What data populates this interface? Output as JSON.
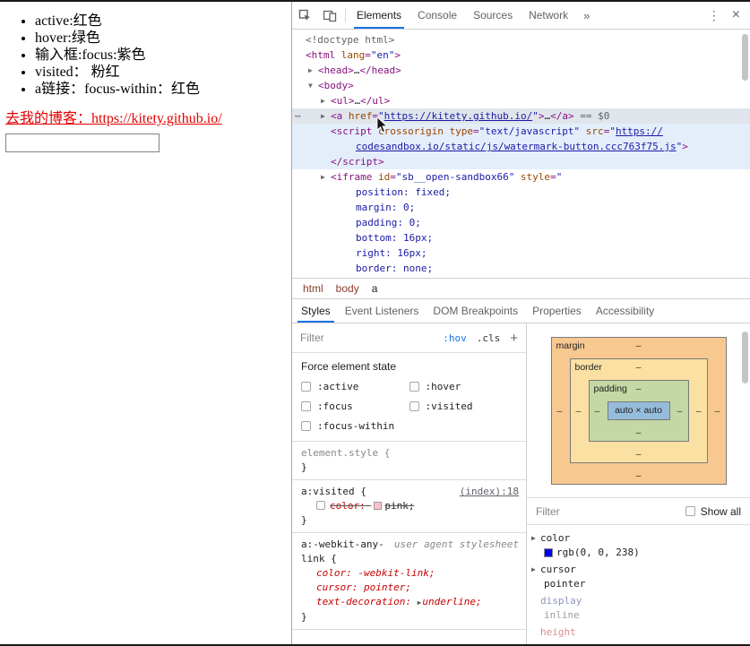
{
  "page": {
    "bullets": [
      "active:红色",
      "hover:绿色",
      "输入框:focus:紫色",
      "visited： 粉红",
      "a链接：focus-within：红色"
    ],
    "link_text": "去我的博客：https://kitety.github.io/"
  },
  "devtools": {
    "icons": {
      "expand": "▶",
      "collapse": "▼"
    },
    "toolbar": {
      "tabs": [
        "Elements",
        "Console",
        "Sources",
        "Network"
      ],
      "more": "»",
      "kebab": "⋮",
      "close": "×"
    },
    "elements": {
      "lines": [
        {
          "lv": 0,
          "segs": [
            [
              "gy",
              "<!doctype html>"
            ]
          ]
        },
        {
          "lv": 0,
          "segs": [
            [
              "tg",
              "<html"
            ],
            [
              "at",
              " lang"
            ],
            [
              "tg",
              "="
            ],
            [
              "vl",
              "\"en\""
            ],
            [
              "tg",
              ">"
            ]
          ]
        },
        {
          "lv": 1,
          "arrow": "▶",
          "segs": [
            [
              "tg",
              "<head>"
            ],
            [
              "tx",
              "…"
            ],
            [
              "tg",
              "</head>"
            ]
          ]
        },
        {
          "lv": 1,
          "arrow": "▼",
          "segs": [
            [
              "tg",
              "<body>"
            ]
          ]
        },
        {
          "lv": 2,
          "arrow": "▶",
          "segs": [
            [
              "tg",
              "<ul>"
            ],
            [
              "tx",
              "…"
            ],
            [
              "tg",
              "</ul>"
            ]
          ]
        },
        {
          "lv": 2,
          "arrow": "▶",
          "sel": true,
          "dots": "⋯",
          "segs": [
            [
              "tg",
              "<a"
            ],
            [
              "at",
              " href"
            ],
            [
              "tg",
              "="
            ],
            [
              "vl",
              "\""
            ],
            [
              "lk",
              "https://kitety.github.io/"
            ],
            [
              "vl",
              "\""
            ],
            [
              "tg",
              ">"
            ],
            [
              "tx",
              "…"
            ],
            [
              "tg",
              "</a>"
            ],
            [
              "mt",
              " == $0"
            ]
          ]
        },
        {
          "lv": 2,
          "hl": true,
          "segs": [
            [
              "tg",
              "<script"
            ],
            [
              "at",
              " crossorigin"
            ],
            [
              "at",
              " type"
            ],
            [
              "tg",
              "="
            ],
            [
              "vl",
              "\"text/javascript\""
            ],
            [
              "at",
              " src"
            ],
            [
              "tg",
              "="
            ],
            [
              "vl",
              "\""
            ],
            [
              "lk",
              "https://"
            ]
          ]
        },
        {
          "lv": 4,
          "hl": true,
          "segs": [
            [
              "lk",
              "codesandbox.io/static/js/watermark-button.ccc763f75.js"
            ],
            [
              "vl",
              "\""
            ],
            [
              "tg",
              ">"
            ]
          ]
        },
        {
          "lv": 2,
          "hl": true,
          "segs": [
            [
              "tg",
              "</script>"
            ]
          ]
        },
        {
          "lv": 2,
          "arrow": "▶",
          "segs": [
            [
              "tg",
              "<iframe"
            ],
            [
              "at",
              " id"
            ],
            [
              "tg",
              "="
            ],
            [
              "vl",
              "\"sb__open-sandbox66\""
            ],
            [
              "at",
              " style"
            ],
            [
              "tg",
              "="
            ],
            [
              "vl",
              "\""
            ]
          ]
        },
        {
          "lv": 4,
          "segs": [
            [
              "vl",
              "position: fixed;"
            ]
          ]
        },
        {
          "lv": 4,
          "segs": [
            [
              "vl",
              "margin: 0;"
            ]
          ]
        },
        {
          "lv": 4,
          "segs": [
            [
              "vl",
              "padding: 0;"
            ]
          ]
        },
        {
          "lv": 4,
          "segs": [
            [
              "vl",
              "bottom: 16px;"
            ]
          ]
        },
        {
          "lv": 4,
          "segs": [
            [
              "vl",
              "right: 16px;"
            ]
          ]
        },
        {
          "lv": 4,
          "segs": [
            [
              "vl",
              "border: none;"
            ]
          ]
        }
      ]
    },
    "crumbs": [
      "html",
      "body",
      "a"
    ],
    "side_tabs": [
      "Styles",
      "Event Listeners",
      "DOM Breakpoints",
      "Properties",
      "Accessibility"
    ],
    "styles": {
      "filter_placeholder": "Filter",
      "pseudo_toggle": ":hov",
      "class_toggle": ".cls",
      "add_rule": "+",
      "force_title": "Force element state",
      "states": [
        ":active",
        ":hover",
        ":focus",
        ":visited",
        ":focus-within"
      ],
      "element_style": {
        "selector": "element.style {",
        "close": "}"
      },
      "visited_rule": {
        "selector": "a:visited {",
        "source": "(index):18",
        "prop": "color:",
        "value": "pink;",
        "swatch": "#ffc0cb",
        "close": "}"
      },
      "ua_rule": {
        "selector": "a:-webkit-any-link {",
        "source": "user agent stylesheet",
        "props": [
          {
            "name": "color:",
            "value": "-webkit-link;"
          },
          {
            "name": "cursor:",
            "value": "pointer;"
          },
          {
            "name": "text-decoration:",
            "value": "underline;"
          }
        ],
        "close": "}"
      }
    },
    "metrics": {
      "margin": "margin",
      "border": "border",
      "padding": "padding",
      "content": "auto × auto",
      "dash": "–"
    },
    "computed": {
      "filter_placeholder": "Filter",
      "show_all": "Show all",
      "properties": [
        {
          "name": "color",
          "value": "rgb(0, 0, 238)",
          "swatch": "#0000ee"
        },
        {
          "name": "cursor",
          "value": "pointer"
        },
        {
          "name": "display",
          "value": "inline"
        },
        {
          "name": "height",
          "value": ""
        }
      ]
    }
  }
}
